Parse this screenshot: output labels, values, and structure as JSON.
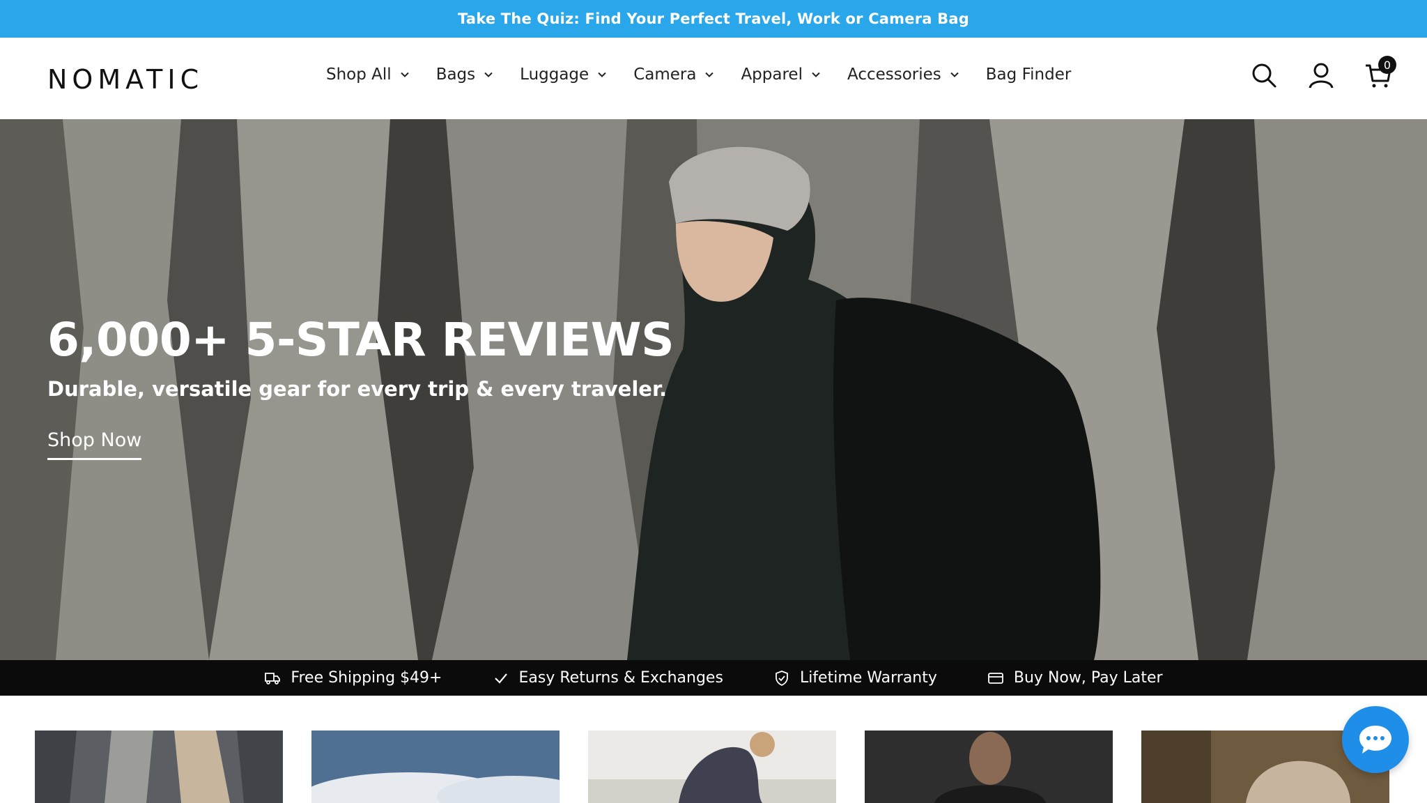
{
  "announcement": {
    "text": "Take The Quiz: Find Your Perfect Travel, Work or Camera Bag"
  },
  "header": {
    "logo": "NOMATIC",
    "nav": [
      {
        "label": "Shop All",
        "dropdown": true
      },
      {
        "label": "Bags",
        "dropdown": true
      },
      {
        "label": "Luggage",
        "dropdown": true
      },
      {
        "label": "Camera",
        "dropdown": true
      },
      {
        "label": "Apparel",
        "dropdown": true
      },
      {
        "label": "Accessories",
        "dropdown": true
      },
      {
        "label": "Bag Finder",
        "dropdown": false
      }
    ],
    "icons": [
      "search-icon",
      "account-icon",
      "cart-icon"
    ],
    "cart_count": "0"
  },
  "hero": {
    "title": "6,000+ 5-STAR REVIEWS",
    "subtitle": "Durable, versatile gear for every trip & every traveler.",
    "cta": "Shop Now"
  },
  "usp_bar": [
    {
      "icon": "shipping-truck-icon",
      "label": "Free Shipping $49+"
    },
    {
      "icon": "check-icon",
      "label": "Easy Returns & Exchanges"
    },
    {
      "icon": "shield-icon",
      "label": "Lifetime Warranty"
    },
    {
      "icon": "credit-card-icon",
      "label": "Buy Now, Pay Later"
    }
  ],
  "colors": {
    "announcement_bg": "#2aa7ea",
    "usp_bg": "#0b0b0b",
    "chat_bg": "#1f8ee8"
  }
}
